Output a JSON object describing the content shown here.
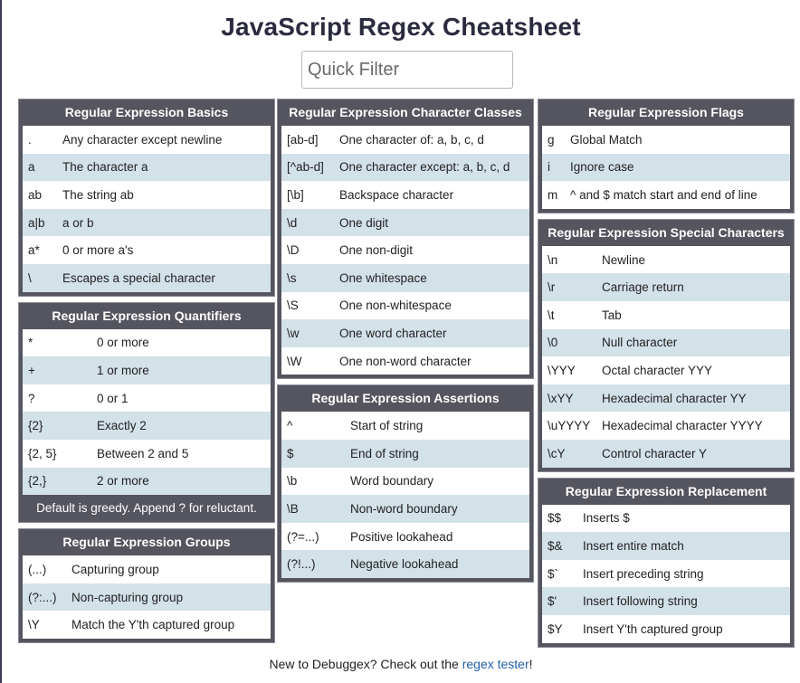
{
  "title": "JavaScript Regex Cheatsheet",
  "filter": {
    "placeholder": "Quick Filter",
    "value": ""
  },
  "colors": {
    "card_header": "#55555f",
    "row_alt": "#d3e1e9",
    "link": "#1f5fa8"
  },
  "sections": {
    "basics": {
      "title": "Regular Expression Basics",
      "rows": [
        {
          "code": ".",
          "desc": "Any character except newline"
        },
        {
          "code": "a",
          "desc": "The character a"
        },
        {
          "code": "ab",
          "desc": "The string ab"
        },
        {
          "code": "a|b",
          "desc": "a or b"
        },
        {
          "code": "a*",
          "desc": "0 or more a's"
        },
        {
          "code": "\\",
          "desc": "Escapes a special character"
        }
      ]
    },
    "quantifiers": {
      "title": "Regular Expression Quantifiers",
      "rows": [
        {
          "code": "*",
          "desc": "0 or more"
        },
        {
          "code": "+",
          "desc": "1 or more"
        },
        {
          "code": "?",
          "desc": "0 or 1"
        },
        {
          "code": "{2}",
          "desc": "Exactly 2"
        },
        {
          "code": "{2, 5}",
          "desc": "Between 2 and 5"
        },
        {
          "code": "{2,}",
          "desc": "2 or more"
        }
      ],
      "note": "Default is greedy. Append ? for reluctant."
    },
    "groups": {
      "title": "Regular Expression Groups",
      "rows": [
        {
          "code": "(...)",
          "desc": "Capturing group"
        },
        {
          "code": "(?:...)",
          "desc": "Non-capturing group"
        },
        {
          "code": "\\Y",
          "desc": "Match the Y'th captured group"
        }
      ]
    },
    "classes": {
      "title": "Regular Expression Character Classes",
      "rows": [
        {
          "code": "[ab-d]",
          "desc": "One character of: a, b, c, d"
        },
        {
          "code": "[^ab-d]",
          "desc": "One character except: a, b, c, d"
        },
        {
          "code": "[\\b]",
          "desc": "Backspace character"
        },
        {
          "code": "\\d",
          "desc": "One digit"
        },
        {
          "code": "\\D",
          "desc": "One non-digit"
        },
        {
          "code": "\\s",
          "desc": "One whitespace"
        },
        {
          "code": "\\S",
          "desc": "One non-whitespace"
        },
        {
          "code": "\\w",
          "desc": "One word character"
        },
        {
          "code": "\\W",
          "desc": "One non-word character"
        }
      ]
    },
    "assertions": {
      "title": "Regular Expression Assertions",
      "rows": [
        {
          "code": "^",
          "desc": "Start of string"
        },
        {
          "code": "$",
          "desc": "End of string"
        },
        {
          "code": "\\b",
          "desc": "Word boundary"
        },
        {
          "code": "\\B",
          "desc": "Non-word boundary"
        },
        {
          "code": "(?=...)",
          "desc": "Positive lookahead"
        },
        {
          "code": "(?!...)",
          "desc": "Negative lookahead"
        }
      ]
    },
    "flags": {
      "title": "Regular Expression Flags",
      "rows": [
        {
          "code": "g",
          "desc": "Global Match"
        },
        {
          "code": "i",
          "desc": "Ignore case"
        },
        {
          "code": "m",
          "desc": "^ and $ match start and end of line"
        }
      ]
    },
    "special": {
      "title": "Regular Expression Special Characters",
      "rows": [
        {
          "code": "\\n",
          "desc": "Newline"
        },
        {
          "code": "\\r",
          "desc": "Carriage return"
        },
        {
          "code": "\\t",
          "desc": "Tab"
        },
        {
          "code": "\\0",
          "desc": "Null character"
        },
        {
          "code": "\\YYY",
          "desc": "Octal character YYY"
        },
        {
          "code": "\\xYY",
          "desc": "Hexadecimal character YY"
        },
        {
          "code": "\\uYYYY",
          "desc": "Hexadecimal character YYYY"
        },
        {
          "code": "\\cY",
          "desc": "Control character Y"
        }
      ]
    },
    "replacement": {
      "title": "Regular Expression Replacement",
      "rows": [
        {
          "code": "$$",
          "desc": "Inserts $"
        },
        {
          "code": "$&",
          "desc": "Insert entire match"
        },
        {
          "code": "$`",
          "desc": "Insert preceding string"
        },
        {
          "code": "$'",
          "desc": "Insert following string"
        },
        {
          "code": "$Y",
          "desc": "Insert Y'th captured group"
        }
      ]
    }
  },
  "footer": {
    "prefix": "New to Debuggex? Check out the ",
    "link": "regex tester",
    "suffix": "!"
  }
}
